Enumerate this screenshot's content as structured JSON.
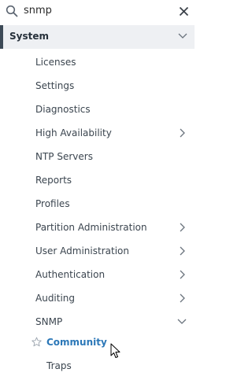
{
  "search": {
    "value": "snmp",
    "icon": "search-icon",
    "clear_icon": "close-icon"
  },
  "section": {
    "label": "System",
    "expanded": true
  },
  "items": [
    {
      "label": "Licenses"
    },
    {
      "label": "Settings"
    },
    {
      "label": "Diagnostics"
    },
    {
      "label": "High Availability",
      "has_children": true
    },
    {
      "label": "NTP Servers"
    },
    {
      "label": "Reports"
    },
    {
      "label": "Profiles"
    },
    {
      "label": "Partition Administration",
      "has_children": true
    },
    {
      "label": "User Administration",
      "has_children": true
    },
    {
      "label": "Authentication",
      "has_children": true
    },
    {
      "label": "Auditing",
      "has_children": true
    },
    {
      "label": "SNMP",
      "expanded": true
    }
  ],
  "snmp_children": [
    {
      "label": "Community",
      "active": true
    },
    {
      "label": "Traps"
    }
  ],
  "colors": {
    "accent": "#2c78b8",
    "section_bg": "#eef0f3",
    "section_bar": "#3d4a57"
  }
}
